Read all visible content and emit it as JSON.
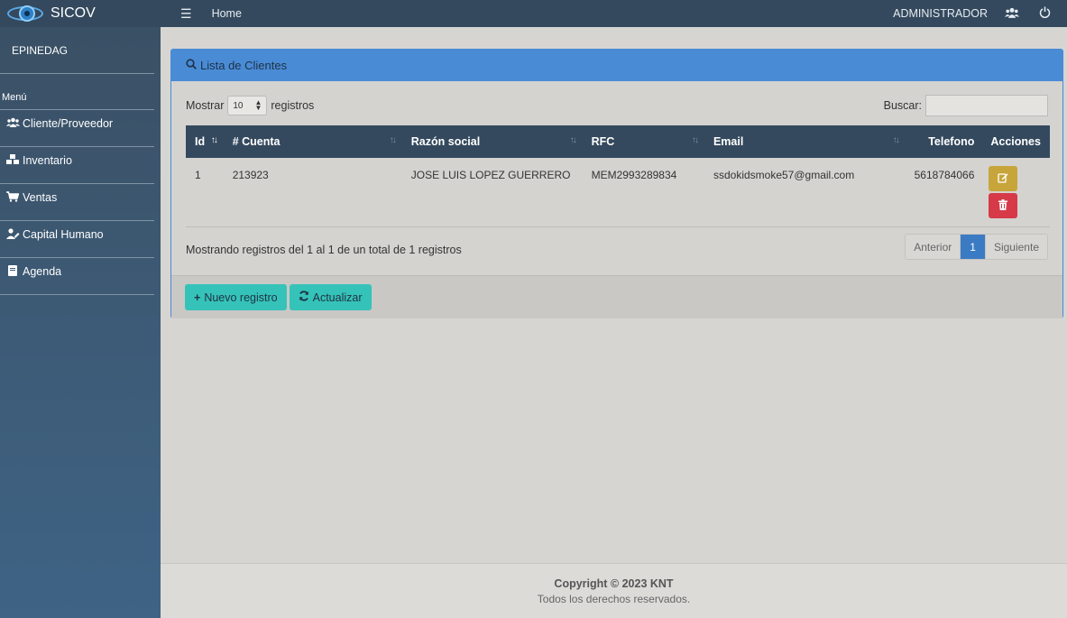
{
  "brand": {
    "name": "SICOV"
  },
  "sidebar": {
    "company": "EPINEDAG",
    "menu_label": "Menú",
    "items": [
      {
        "label": "Cliente/Proveedor",
        "icon": "users-icon"
      },
      {
        "label": "Inventario",
        "icon": "boxes-icon"
      },
      {
        "label": "Ventas",
        "icon": "cart-icon"
      },
      {
        "label": "Capital Humano",
        "icon": "user-edit-icon"
      },
      {
        "label": "Agenda",
        "icon": "book-icon"
      }
    ]
  },
  "topbar": {
    "home": "Home",
    "user": "ADMINISTRADOR"
  },
  "card": {
    "title": "Lista de Clientes",
    "show_label": "Mostrar",
    "page_size": "10",
    "records_label": "registros",
    "search_label": "Buscar:",
    "search_value": "",
    "columns": [
      "Id",
      "# Cuenta",
      "Razón social",
      "RFC",
      "Email",
      "Telefono",
      "Acciones"
    ],
    "rows": [
      {
        "id": "1",
        "cuenta": "213923",
        "razon": "JOSE LUIS LOPEZ GUERRERO",
        "rfc": "MEM2993289834",
        "email": "ssdokidsmoke57@gmail.com",
        "telefono": "5618784066"
      }
    ],
    "info": "Mostrando registros del 1 al 1 de un total de 1 registros",
    "pager": {
      "prev": "Anterior",
      "current": "1",
      "next": "Siguiente"
    },
    "new_button": "Nuevo registro",
    "refresh_button": "Actualizar"
  },
  "footer": {
    "copyright": "Copyright © 2023 KNT",
    "rights": "Todos los derechos reservados."
  },
  "colors": {
    "header_bar": "#34495e",
    "card_header": "#4a8bd6",
    "teal": "#35c3b9",
    "edit": "#c8a53b",
    "delete": "#d63a48"
  }
}
